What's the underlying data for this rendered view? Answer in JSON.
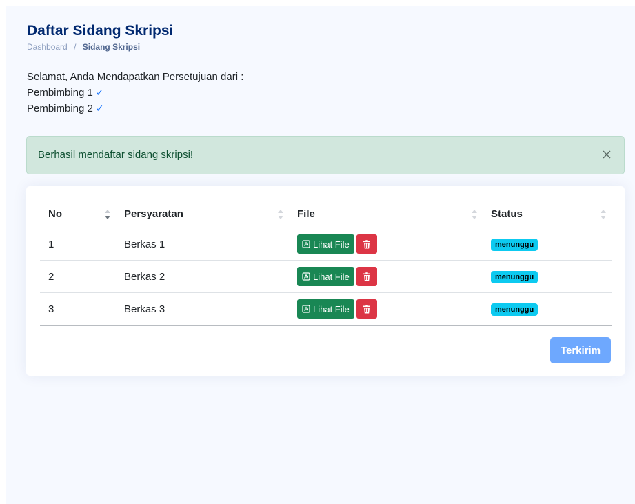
{
  "header": {
    "title": "Daftar Sidang Skripsi",
    "breadcrumb": [
      "Dashboard",
      "/",
      "Sidang Skripsi"
    ]
  },
  "approval": {
    "intro": "Selamat, Anda Mendapatkan Persetujuan dari :",
    "items": [
      "Pembimbing 1",
      "Pembimbing 2"
    ],
    "check_icon": "check-icon"
  },
  "alert": {
    "message": "Berhasil mendaftar sidang skripsi!",
    "close_icon": "close-icon"
  },
  "table": {
    "columns": [
      "No",
      "Persyaratan",
      "File",
      "Status"
    ],
    "rows": [
      {
        "no": "1",
        "persyaratan": "Berkas 1",
        "file_label": "Lihat File",
        "status": "menunggu"
      },
      {
        "no": "2",
        "persyaratan": "Berkas 2",
        "file_label": "Lihat File",
        "status": "menunggu"
      },
      {
        "no": "3",
        "persyaratan": "Berkas 3",
        "file_label": "Lihat File",
        "status": "menunggu"
      }
    ]
  },
  "submit_label": "Terkirim",
  "colors": {
    "title": "#012970",
    "alert_bg": "#d1e7dd",
    "file_button": "#198754",
    "delete_button": "#dc3545",
    "status_badge": "#0dcaf0",
    "submit_button": "#6ea8fe"
  }
}
